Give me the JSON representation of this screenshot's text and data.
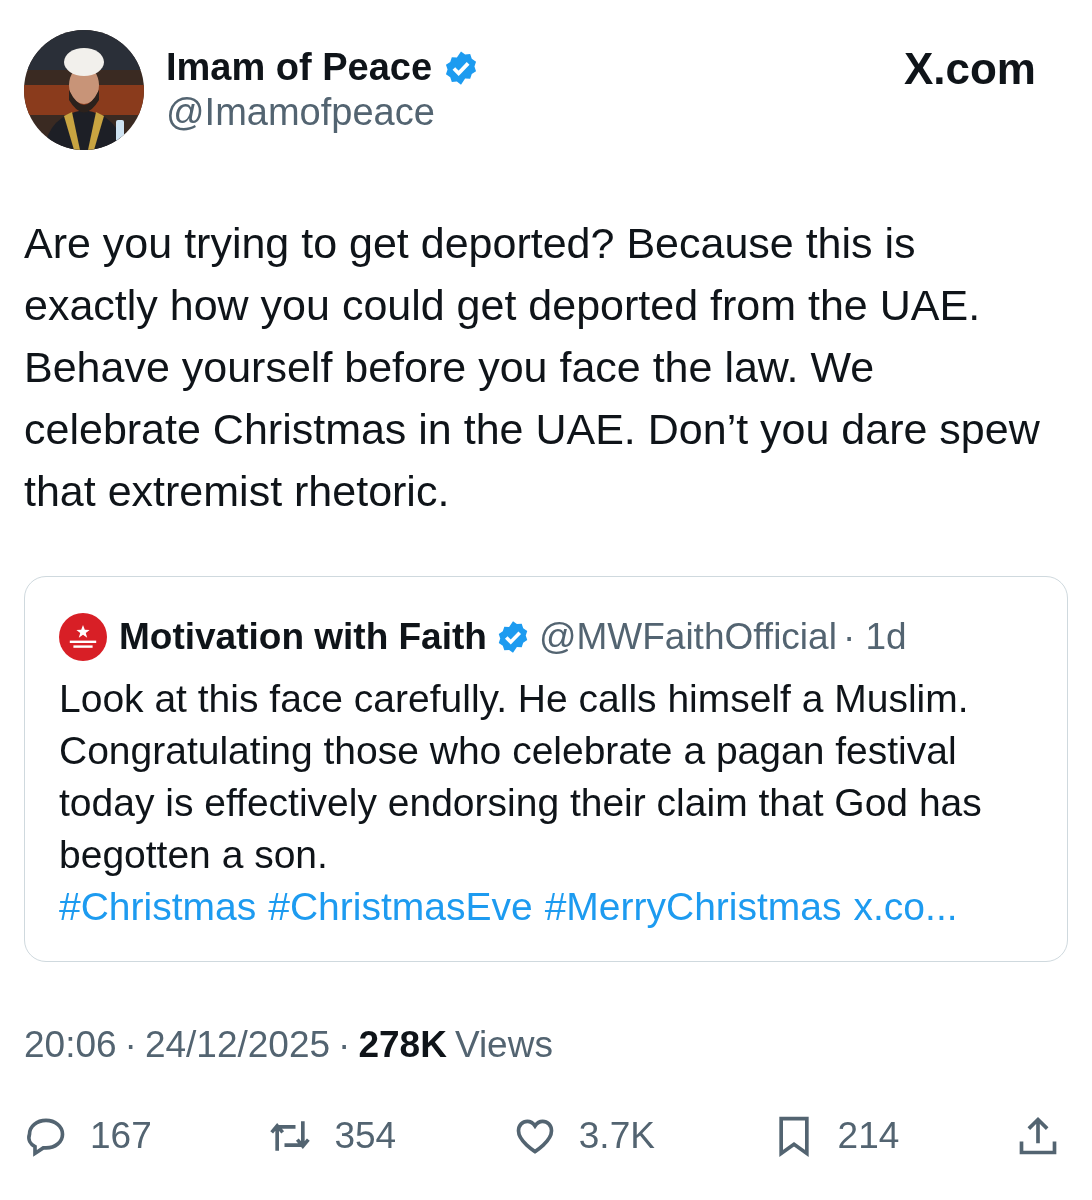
{
  "author": {
    "name": "Imam of Peace",
    "handle": "@Imamofpeace",
    "verified": true
  },
  "site": "X.com",
  "text": "Are you trying to get deported? Because this is exactly how you could get deported from the UAE. Behave yourself before you face the law. We celebrate Christmas in the UAE. Don’t you dare spew that extremist rhetoric.",
  "quote": {
    "name": "Motivation with Faith",
    "verified": true,
    "handle": "@MWFaithOfficial",
    "time": "· 1d",
    "text": "Look at this face carefully. He calls himself a Muslim. Congratulating those who celebrate a pagan festival today is effectively endorsing their claim that God has begotten a son.",
    "links": [
      "#Christmas",
      "#ChristmasEve",
      "#MerryChristmas",
      "x.co..."
    ]
  },
  "meta": {
    "separator": "·",
    "time": "20:06",
    "date": "24/12/2025",
    "views_count": "278K",
    "views_label": "Views"
  },
  "actions": [
    {
      "kind": "reply",
      "count": "167"
    },
    {
      "kind": "repost",
      "count": "354"
    },
    {
      "kind": "like",
      "count": "3.7K"
    },
    {
      "kind": "bookmark",
      "count": "214"
    },
    {
      "kind": "share"
    }
  ]
}
